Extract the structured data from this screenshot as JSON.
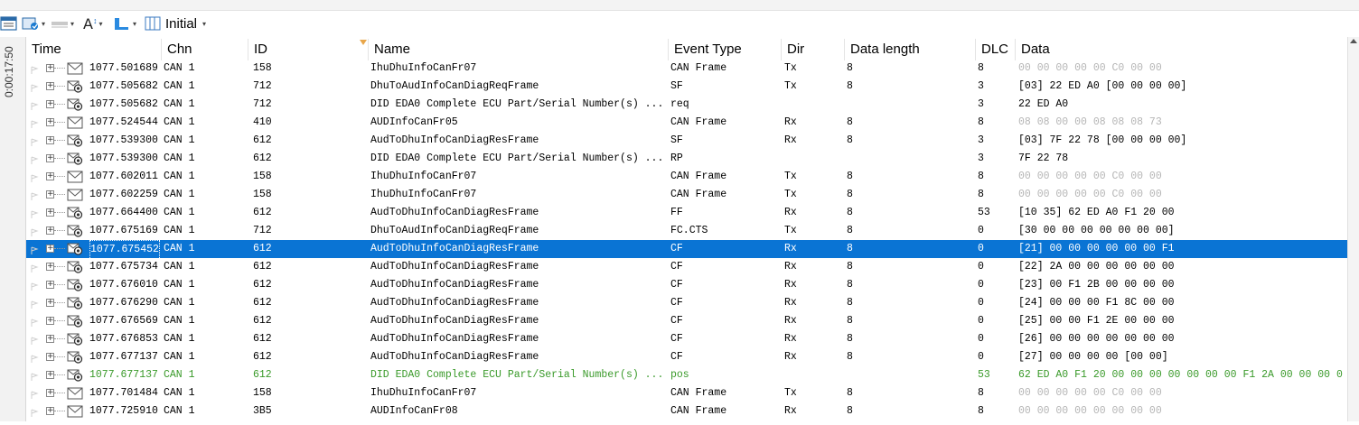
{
  "toolbar": {
    "layout_label": "Initial",
    "icons": [
      "window-icon",
      "open-config-icon",
      "filter-icon",
      "font-size-icon",
      "column-chart-icon",
      "layout-icon"
    ]
  },
  "sidebar": {
    "time_label": "0:00:17:50"
  },
  "columns": [
    "Time",
    "Chn",
    "ID",
    "Name",
    "Event Type",
    "Dir",
    "Data length",
    "DLC",
    "Data"
  ],
  "colors": {
    "selection": "#0a74d4",
    "green_row": "#3a9a2a",
    "gray_data": "#b5b5b5"
  },
  "rows": [
    {
      "icon": "envelope",
      "time": "1077.501689",
      "chn": "CAN 1",
      "id": "158",
      "name": "IhuDhuInfoCanFr07",
      "event": "CAN Frame",
      "dir": "Tx",
      "len": "8",
      "dlc": "8",
      "data": "00 00 00 00 00 C0 00 00",
      "gray": true
    },
    {
      "icon": "diag",
      "time": "1077.505682",
      "chn": "CAN 1",
      "id": "712",
      "name": "DhuToAudInfoCanDiagReqFrame",
      "event": "SF",
      "dir": "Tx",
      "len": "8",
      "dlc": "3",
      "data": "[03] 22 ED A0 [00 00 00 00]",
      "gray": false
    },
    {
      "icon": "diag",
      "time": "1077.505682",
      "chn": "CAN 1",
      "id": "712",
      "name": "DID EDA0 Complete ECU Part/Serial Number(s) ...",
      "event": "req",
      "dir": "",
      "len": "",
      "dlc": "3",
      "data": "22 ED A0",
      "gray": false
    },
    {
      "icon": "envelope",
      "time": "1077.524544",
      "chn": "CAN 1",
      "id": "410",
      "name": "AUDInfoCanFr05",
      "event": "CAN Frame",
      "dir": "Rx",
      "len": "8",
      "dlc": "8",
      "data": "08 08 00 00 08 08 08 73",
      "gray": true
    },
    {
      "icon": "diag",
      "time": "1077.539300",
      "chn": "CAN 1",
      "id": "612",
      "name": "AudToDhuInfoCanDiagResFrame",
      "event": "SF",
      "dir": "Rx",
      "len": "8",
      "dlc": "3",
      "data": "[03] 7F 22 78 [00 00 00 00]",
      "gray": false
    },
    {
      "icon": "diag",
      "time": "1077.539300",
      "chn": "CAN 1",
      "id": "612",
      "name": "DID EDA0 Complete ECU Part/Serial Number(s) ...",
      "event": "RP",
      "dir": "",
      "len": "",
      "dlc": "3",
      "data": "7F 22 78",
      "gray": false
    },
    {
      "icon": "envelope",
      "time": "1077.602011",
      "chn": "CAN 1",
      "id": "158",
      "name": "IhuDhuInfoCanFr07",
      "event": "CAN Frame",
      "dir": "Tx",
      "len": "8",
      "dlc": "8",
      "data": "00 00 00 00 00 C0 00 00",
      "gray": true
    },
    {
      "icon": "envelope",
      "time": "1077.602259",
      "chn": "CAN 1",
      "id": "158",
      "name": "IhuDhuInfoCanFr07",
      "event": "CAN Frame",
      "dir": "Tx",
      "len": "8",
      "dlc": "8",
      "data": "00 00 00 00 00 C0 00 00",
      "gray": true
    },
    {
      "icon": "diag",
      "time": "1077.664400",
      "chn": "CAN 1",
      "id": "612",
      "name": "AudToDhuInfoCanDiagResFrame",
      "event": "FF",
      "dir": "Rx",
      "len": "8",
      "dlc": "53",
      "data": "[10 35] 62 ED A0 F1 20 00",
      "gray": false
    },
    {
      "icon": "diag",
      "time": "1077.675169",
      "chn": "CAN 1",
      "id": "712",
      "name": "DhuToAudInfoCanDiagReqFrame",
      "event": "FC.CTS",
      "dir": "Tx",
      "len": "8",
      "dlc": "0",
      "data": "[30 00 00 00 00 00 00 00]",
      "gray": false
    },
    {
      "icon": "diag",
      "time": "1077.675452",
      "chn": "CAN 1",
      "id": "612",
      "name": "AudToDhuInfoCanDiagResFrame",
      "event": "CF",
      "dir": "Rx",
      "len": "8",
      "dlc": "0",
      "data": "[21] 00 00 00 00 00 00 F1",
      "gray": false,
      "selected": true
    },
    {
      "icon": "diag",
      "time": "1077.675734",
      "chn": "CAN 1",
      "id": "612",
      "name": "AudToDhuInfoCanDiagResFrame",
      "event": "CF",
      "dir": "Rx",
      "len": "8",
      "dlc": "0",
      "data": "[22] 2A 00 00 00 00 00 00",
      "gray": false
    },
    {
      "icon": "diag",
      "time": "1077.676010",
      "chn": "CAN 1",
      "id": "612",
      "name": "AudToDhuInfoCanDiagResFrame",
      "event": "CF",
      "dir": "Rx",
      "len": "8",
      "dlc": "0",
      "data": "[23] 00 F1 2B 00 00 00 00",
      "gray": false
    },
    {
      "icon": "diag",
      "time": "1077.676290",
      "chn": "CAN 1",
      "id": "612",
      "name": "AudToDhuInfoCanDiagResFrame",
      "event": "CF",
      "dir": "Rx",
      "len": "8",
      "dlc": "0",
      "data": "[24] 00 00 00 F1 8C 00 00",
      "gray": false
    },
    {
      "icon": "diag",
      "time": "1077.676569",
      "chn": "CAN 1",
      "id": "612",
      "name": "AudToDhuInfoCanDiagResFrame",
      "event": "CF",
      "dir": "Rx",
      "len": "8",
      "dlc": "0",
      "data": "[25] 00 00 F1 2E 00 00 00",
      "gray": false
    },
    {
      "icon": "diag",
      "time": "1077.676853",
      "chn": "CAN 1",
      "id": "612",
      "name": "AudToDhuInfoCanDiagResFrame",
      "event": "CF",
      "dir": "Rx",
      "len": "8",
      "dlc": "0",
      "data": "[26] 00 00 00 00 00 00 00",
      "gray": false
    },
    {
      "icon": "diag",
      "time": "1077.677137",
      "chn": "CAN 1",
      "id": "612",
      "name": "AudToDhuInfoCanDiagResFrame",
      "event": "CF",
      "dir": "Rx",
      "len": "8",
      "dlc": "0",
      "data": "[27] 00 00 00 00 [00 00]",
      "gray": false
    },
    {
      "icon": "diag",
      "time": "1077.677137",
      "chn": "CAN 1",
      "id": "612",
      "name": "DID EDA0 Complete ECU Part/Serial Number(s) ...",
      "event": "pos",
      "dir": "",
      "len": "",
      "dlc": "53",
      "data": "62 ED A0 F1 20 00 00 00 00 00 00 00 F1 2A 00 00 00 0",
      "gray": false,
      "green": true
    },
    {
      "icon": "envelope",
      "time": "1077.701484",
      "chn": "CAN 1",
      "id": "158",
      "name": "IhuDhuInfoCanFr07",
      "event": "CAN Frame",
      "dir": "Tx",
      "len": "8",
      "dlc": "8",
      "data": "00 00 00 00 00 C0 00 00",
      "gray": true
    },
    {
      "icon": "envelope",
      "time": "1077.725910",
      "chn": "CAN 1",
      "id": "3B5",
      "name": "AUDInfoCanFr08",
      "event": "CAN Frame",
      "dir": "Rx",
      "len": "8",
      "dlc": "8",
      "data": "00 00 00 00 00 00 00 00",
      "gray": true
    }
  ]
}
